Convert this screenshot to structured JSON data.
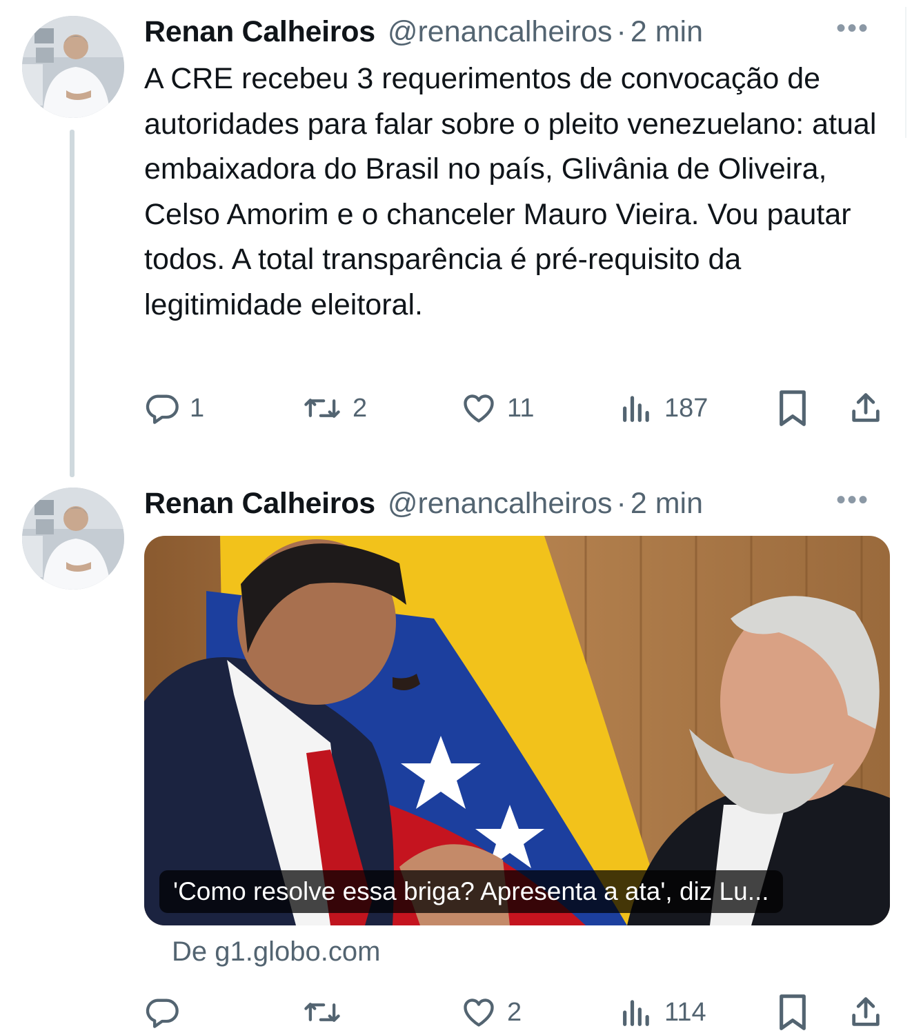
{
  "tweets": [
    {
      "author_name": "Renan Calheiros",
      "handle": "@renancalheiros",
      "separator": "·",
      "time": "2 min",
      "more": "•••",
      "text": "A CRE recebeu 3 requerimentos de convocação de autoridades para falar sobre o pleito venezuelano: atual embaixadora do Brasil no país, Glivânia de Oliveira, Celso Amorim e o chanceler Mauro Vieira. Vou pautar todos. A total transparência é pré-requisito da legitimidade eleitoral.",
      "replies": "1",
      "retweets": "2",
      "likes": "11",
      "views": "187"
    },
    {
      "author_name": "Renan Calheiros",
      "handle": "@renancalheiros",
      "separator": "·",
      "time": "2 min",
      "more": "•••",
      "card_caption": "'Como resolve essa briga? Apresenta a ata', diz Lu...",
      "card_source": "De g1.globo.com",
      "replies": "",
      "retweets": "",
      "likes": "2",
      "views": "114"
    }
  ],
  "icons": {
    "reply": "reply-icon",
    "retweet": "retweet-icon",
    "like": "heart-icon",
    "views": "views-icon",
    "bookmark": "bookmark-icon",
    "share": "share-icon"
  },
  "colors": {
    "text": "#0f1419",
    "secondary": "#536471",
    "thread_line": "#cfd9de"
  }
}
